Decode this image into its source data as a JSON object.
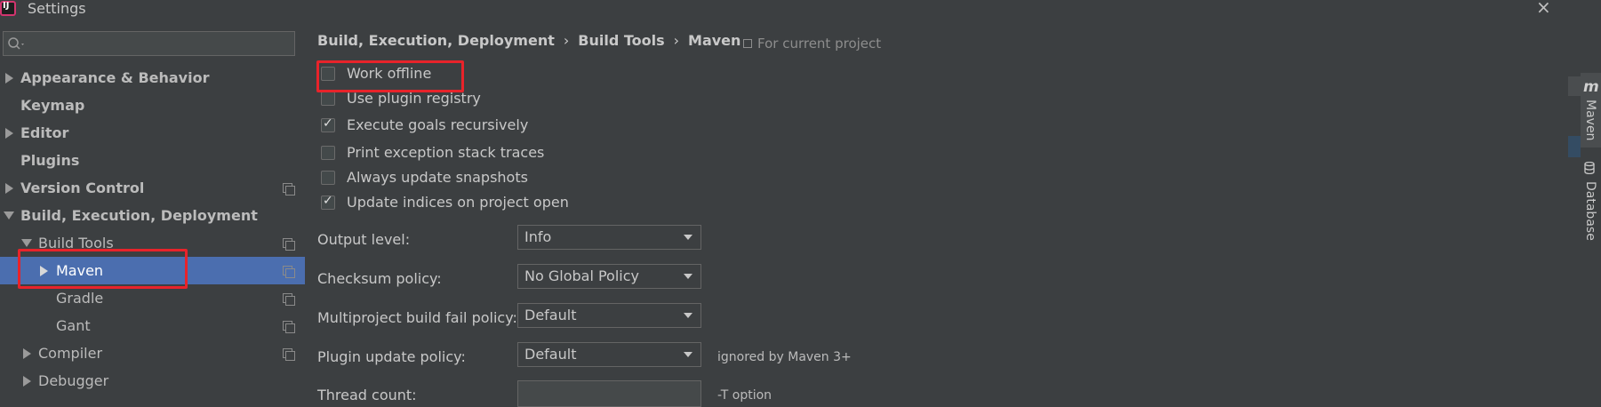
{
  "window": {
    "title": "Settings",
    "close_glyph": "×"
  },
  "search": {
    "placeholder": ""
  },
  "tree": [
    {
      "label": "Appearance & Behavior",
      "bold": true
    },
    {
      "label": "Keymap",
      "bold": true
    },
    {
      "label": "Editor",
      "bold": true
    },
    {
      "label": "Plugins",
      "bold": true
    },
    {
      "label": "Version Control",
      "bold": true
    },
    {
      "label": "Build, Execution, Deployment",
      "bold": true
    },
    {
      "label": "Build Tools",
      "bold": false
    },
    {
      "label": "Maven",
      "bold": false,
      "selected": true
    },
    {
      "label": "Gradle",
      "bold": false
    },
    {
      "label": "Gant",
      "bold": false
    },
    {
      "label": "Compiler",
      "bold": false
    },
    {
      "label": "Debugger",
      "bold": false
    }
  ],
  "breadcrumb": {
    "items": [
      "Build, Execution, Deployment",
      "Build Tools",
      "Maven"
    ],
    "separator": "›"
  },
  "for_current_project": "For current project",
  "options": [
    {
      "label": "Work offline",
      "checked": false
    },
    {
      "label": "Use plugin registry",
      "checked": false
    },
    {
      "label": "Execute goals recursively",
      "checked": true
    },
    {
      "label": "Print exception stack traces",
      "checked": false
    },
    {
      "label": "Always update snapshots",
      "checked": false
    },
    {
      "label": "Update indices on project open",
      "checked": true
    }
  ],
  "form": {
    "output_level": {
      "label": "Output level:",
      "value": "Info"
    },
    "checksum_policy": {
      "label": "Checksum policy:",
      "value": "No Global Policy"
    },
    "multiproject_fail_policy": {
      "label": "Multiproject build fail policy:",
      "value": "Default"
    },
    "plugin_update_policy": {
      "label": "Plugin update policy:",
      "value": "Default",
      "hint": "ignored by Maven 3+"
    },
    "thread_count": {
      "label": "Thread count:",
      "value": "",
      "hint": "-T option"
    }
  },
  "tool_windows": {
    "maven": "Maven",
    "database": "Database",
    "maven_icon": "m"
  },
  "colors": {
    "highlight": "#e8232a",
    "selection": "#4b6eaf",
    "background": "#3c3f41"
  }
}
